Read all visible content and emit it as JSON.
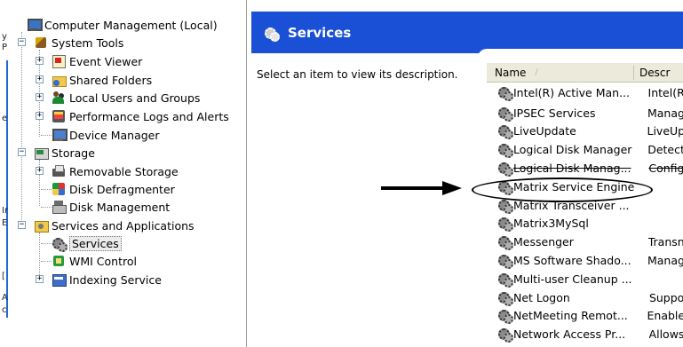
{
  "background_window": {
    "edge_chars": [
      "y",
      "P",
      "e",
      "Ir",
      "E",
      "[",
      "A",
      "c"
    ]
  },
  "tree": {
    "root": "Computer Management (Local)",
    "system_tools": "System Tools",
    "event_viewer": "Event Viewer",
    "shared_folders": "Shared Folders",
    "local_users": "Local Users and Groups",
    "perf_logs": "Performance Logs and Alerts",
    "device_manager": "Device Manager",
    "storage": "Storage",
    "removable_storage": "Removable Storage",
    "disk_defrag": "Disk Defragmenter",
    "disk_management": "Disk Management",
    "services_apps": "Services and Applications",
    "services": "Services",
    "wmi_control": "WMI Control",
    "indexing_service": "Indexing Service",
    "expander_plus": "+",
    "expander_minus": "−"
  },
  "banner": {
    "title": "Services"
  },
  "description_pane": {
    "text": "Select an item to view its description."
  },
  "list": {
    "columns": {
      "name": "Name",
      "description": "Descr",
      "sort_glyph": "/"
    },
    "rows": [
      {
        "name": "Intel(R) Active Man...",
        "desc": "Intel(R"
      },
      {
        "name": "IPSEC Services",
        "desc": "Manag"
      },
      {
        "name": "LiveUpdate",
        "desc": "LiveUp"
      },
      {
        "name": "Logical Disk Manager",
        "desc": "Detect"
      },
      {
        "name": "Logical Disk Manag...",
        "desc": "Config"
      },
      {
        "name": "Matrix Service Engine",
        "desc": ""
      },
      {
        "name": "Matrix Transceiver ...",
        "desc": ""
      },
      {
        "name": "Matrix3MySql",
        "desc": ""
      },
      {
        "name": "Messenger",
        "desc": "Transn"
      },
      {
        "name": "MS Software Shado...",
        "desc": "Manag"
      },
      {
        "name": "Multi-user Cleanup ...",
        "desc": ""
      },
      {
        "name": "Net Logon",
        "desc": "Suppo"
      },
      {
        "name": "NetMeeting Remot...",
        "desc": "Enable"
      },
      {
        "name": "Network Access Pr...",
        "desc": "Allows"
      }
    ]
  },
  "colors": {
    "banner": "#1a50d6",
    "header": "#ebeadb",
    "annotation": "#000000"
  },
  "icons": {
    "root": "computer-icon",
    "services": "gears-icon"
  }
}
